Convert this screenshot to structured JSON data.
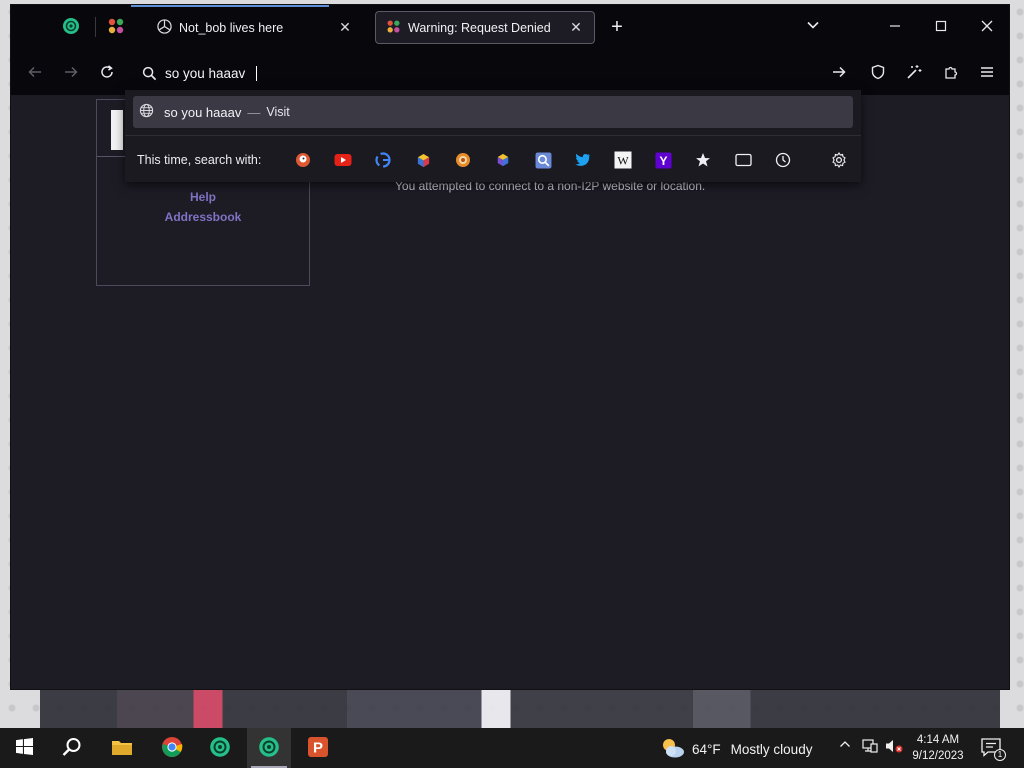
{
  "browser": {
    "tabs": [
      {
        "title": "Not_bob lives here",
        "active": false
      },
      {
        "title": "Warning: Request Denied",
        "active": true
      }
    ],
    "new_tab_symbol": "+",
    "close_symbol": "✕"
  },
  "toolbar": {
    "url_value": "so you haaav"
  },
  "dropdown": {
    "suggestion_text": "so you haaav",
    "suggestion_separator": "—",
    "suggestion_action": "Visit",
    "search_with_label": "This time, search with:",
    "engines": [
      "duckduckgo-icon",
      "youtube-icon",
      "google-icon",
      "cube-icon",
      "i2p-search-icon",
      "cube-purple-icon",
      "blue-search-icon",
      "twitter-icon",
      "wikipedia-icon",
      "yahoo-icon",
      "bookmarks-icon",
      "tabs-icon",
      "history-icon"
    ]
  },
  "page": {
    "side_links": [
      "Help",
      "Addressbook"
    ],
    "message": "You attempted to connect to a non-I2P website or location."
  },
  "taskbar": {
    "weather_temp": "64°F",
    "weather_desc": "Mostly cloudy",
    "time": "4:14 AM",
    "date": "9/12/2023",
    "notification_count": "1"
  },
  "colors": {
    "accent": "#5f8fd6",
    "window_bg": "#1d1b24",
    "chrome_bg": "#08070b",
    "link": "#7f73c4"
  }
}
